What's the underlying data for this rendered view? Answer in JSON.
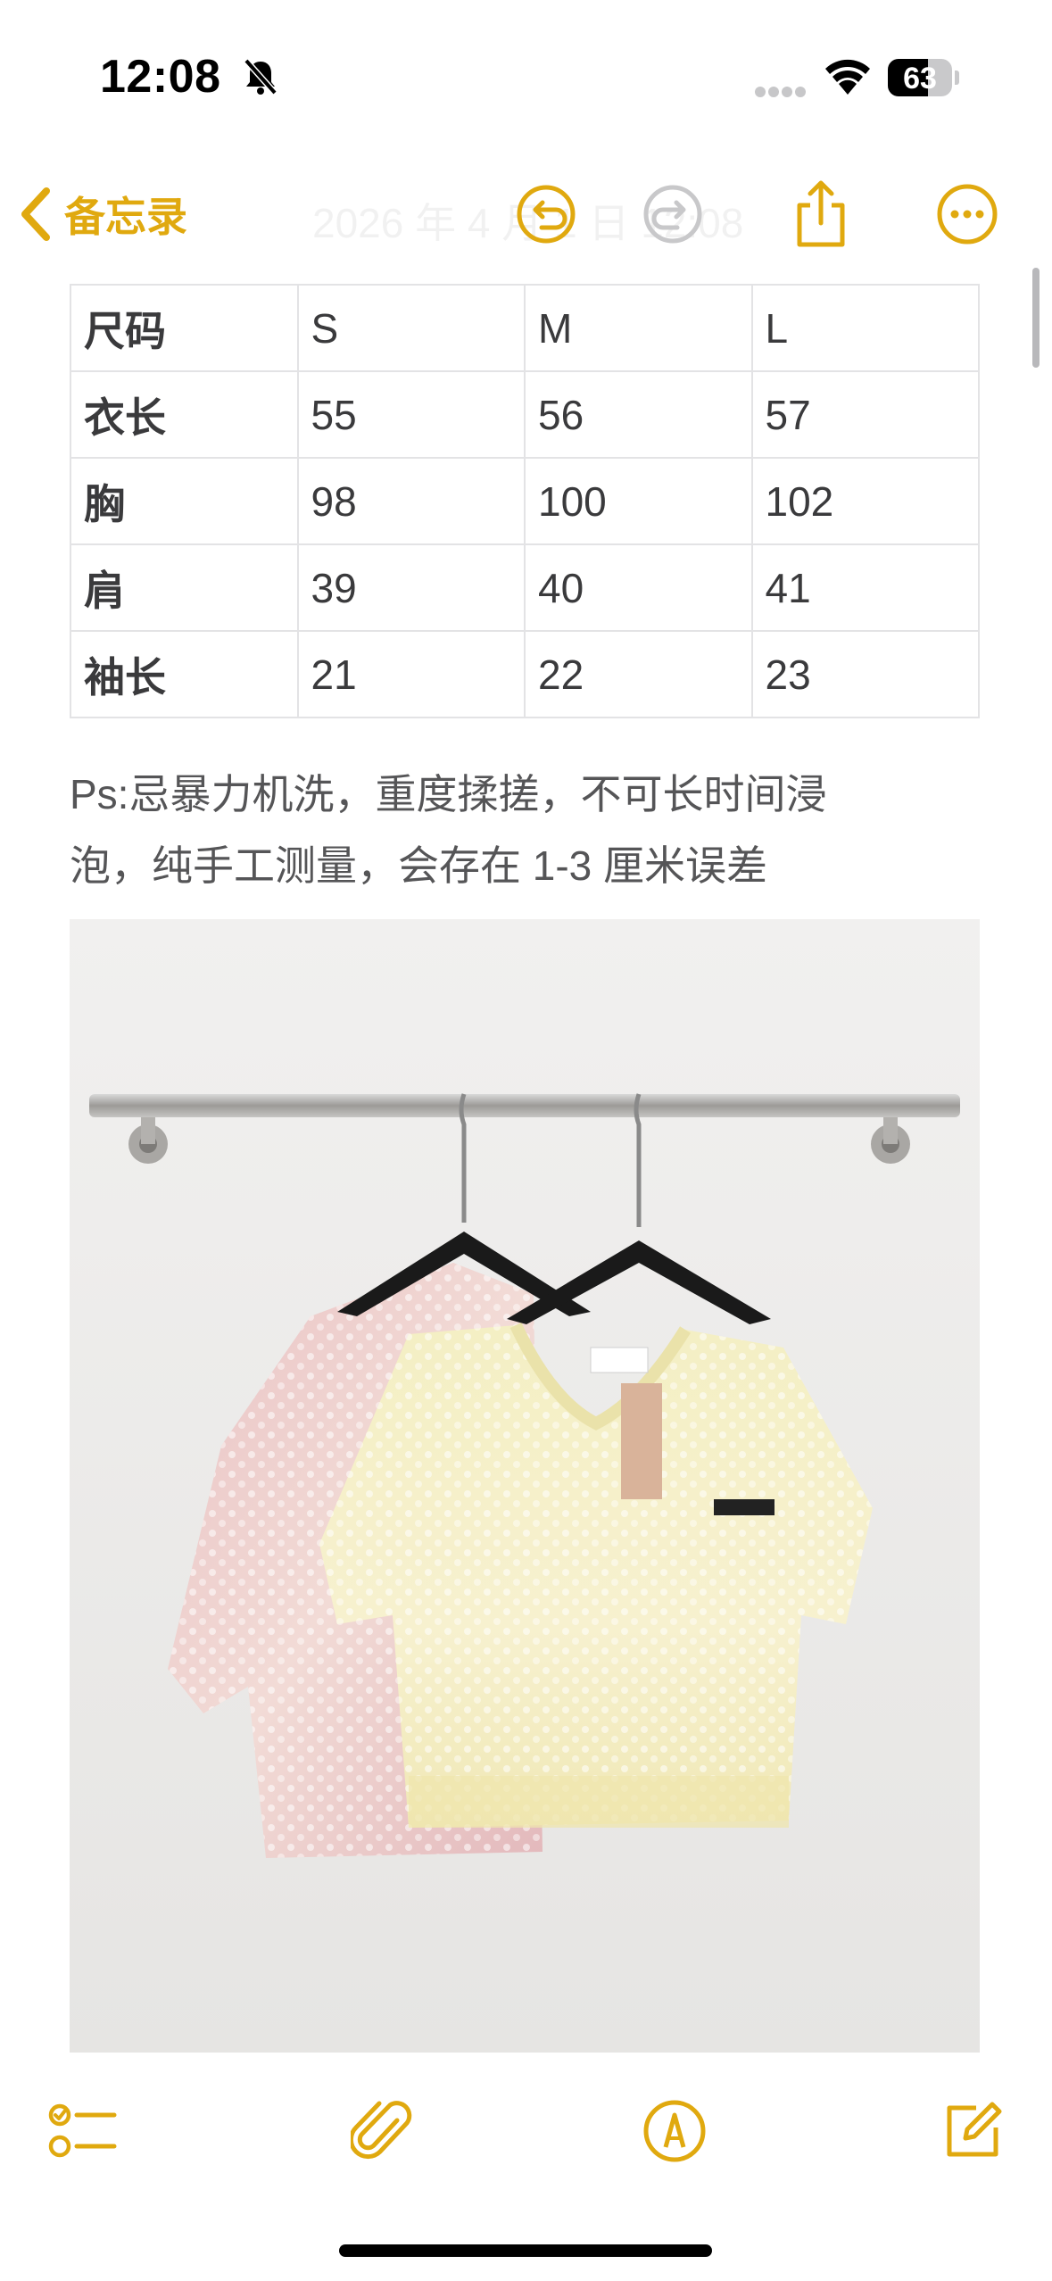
{
  "status_bar": {
    "time": "12:08",
    "battery_percent": "63",
    "battery_level": 0.63,
    "icons": [
      "bell-slash-icon",
      "cellular-signal-icon",
      "wifi-icon",
      "battery-icon"
    ]
  },
  "nav": {
    "back_label": "备忘录",
    "title_faded": "2026 年 4 月 1 日 12:08",
    "icons": [
      "chevron-left-icon",
      "undo-icon",
      "redo-icon",
      "share-icon",
      "more-icon"
    ]
  },
  "colors": {
    "accent": "#e0a90f",
    "table_border": "#e3e3e5",
    "text_gray": "#555557"
  },
  "size_table": {
    "header": [
      "尺码",
      "S",
      "M",
      "L"
    ],
    "rows": [
      [
        "衣长",
        "55",
        "56",
        "57"
      ],
      [
        "胸",
        "98",
        "100",
        "102"
      ],
      [
        "肩",
        "39",
        "40",
        "41"
      ],
      [
        "袖长",
        "21",
        "22",
        "23"
      ]
    ]
  },
  "note": {
    "line1": "Ps:忌暴力机洗，重度揉搓，不可长时间浸",
    "line2": "泡，纯手工测量，会存在 1-3 厘米误差"
  },
  "photo": {
    "description_icon": "product-photo"
  },
  "toolbar": {
    "icons": [
      "checklist-icon",
      "paperclip-icon",
      "markup-pen-icon",
      "compose-icon"
    ]
  }
}
